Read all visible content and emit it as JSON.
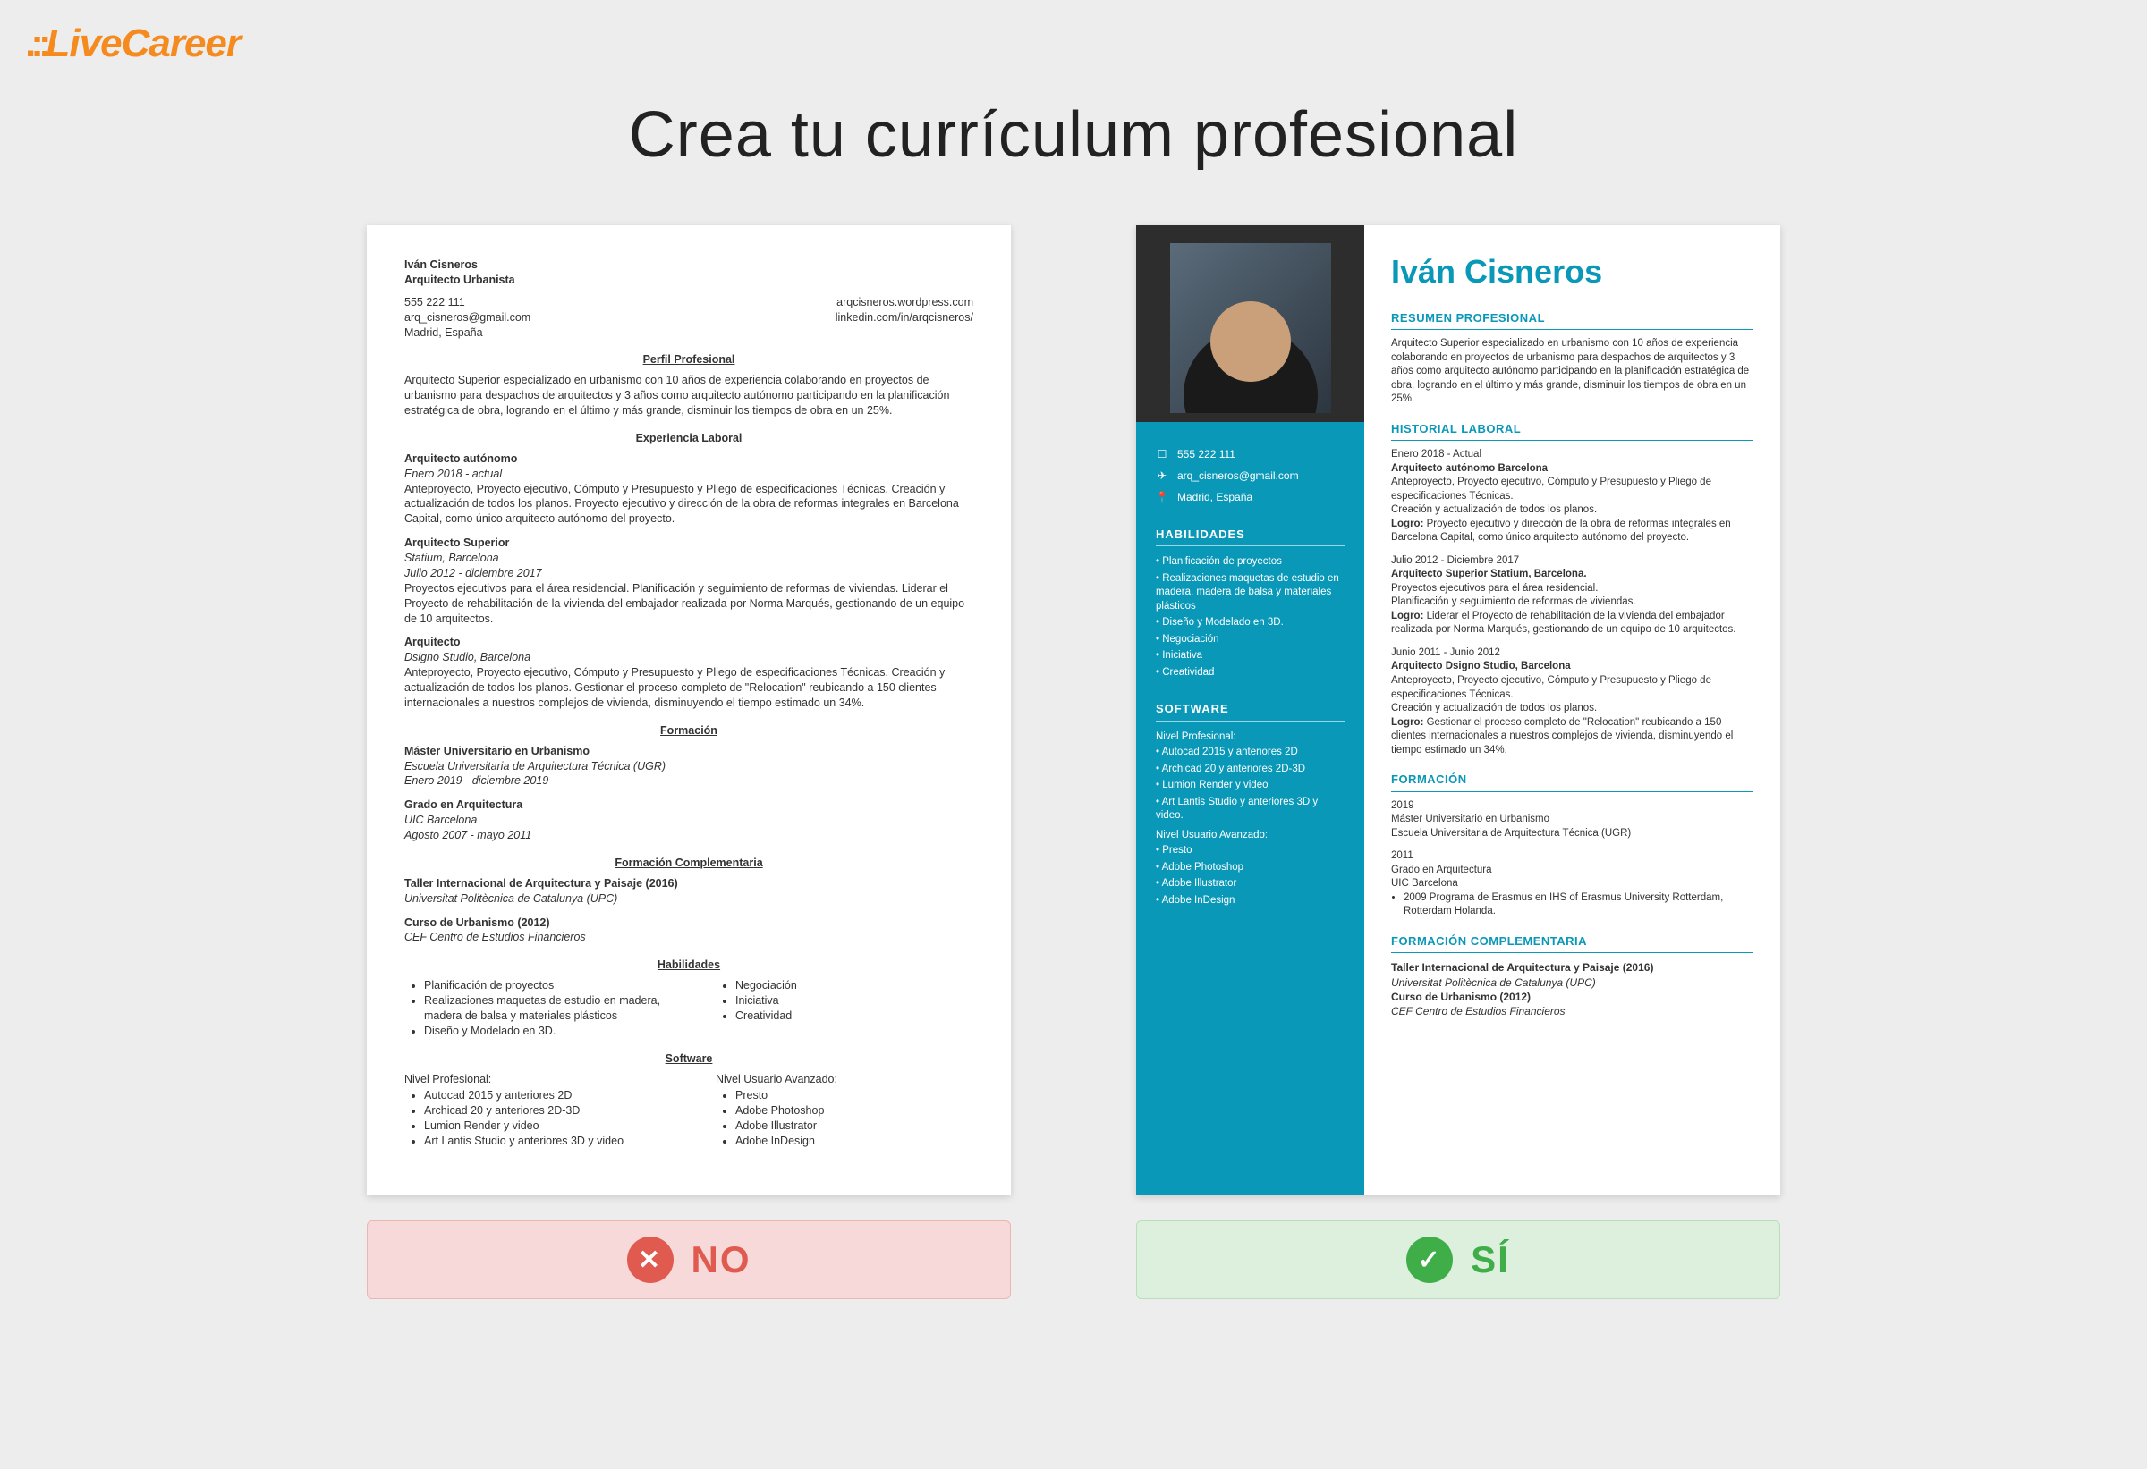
{
  "logo": "LiveCareer",
  "title": "Crea tu currículum profesional",
  "badges": {
    "no": "NO",
    "si": "SÍ"
  },
  "bad": {
    "name": "Iván Cisneros",
    "role": "Arquitecto Urbanista",
    "contact": {
      "phone": "555 222 111",
      "web": "arqcisneros.wordpress.com",
      "email": "arq_cisneros@gmail.com",
      "linkedin": "linkedin.com/in/arqcisneros/",
      "loc": "Madrid, España"
    },
    "sections": {
      "perfil_h": "Perfil Profesional",
      "perfil": "Arquitecto Superior especializado en urbanismo con 10 años de experiencia colaborando en proyectos de urbanismo para despachos de arquitectos y 3 años como arquitecto autónomo participando en la planificación estratégica de obra, logrando en el último y más grande, disminuir los tiempos de obra en un 25%.",
      "exp_h": "Experiencia Laboral",
      "jobs": [
        {
          "t": "Arquitecto autónomo",
          "d": "Enero 2018 - actual",
          "body": "Anteproyecto, Proyecto ejecutivo, Cómputo y Presupuesto y Pliego de especificaciones Técnicas. Creación y actualización de todos los planos. Proyecto ejecutivo y dirección de la obra de reformas integrales en Barcelona Capital, como único arquitecto autónomo del proyecto."
        },
        {
          "t": "Arquitecto Superior",
          "c": "Statium, Barcelona",
          "d": "Julio 2012 - diciembre 2017",
          "body": "Proyectos ejecutivos para el área residencial. Planificación y seguimiento de reformas de viviendas. Liderar el Proyecto de rehabilitación de la vivienda del embajador realizada por Norma Marqués, gestionando de un equipo de 10 arquitectos."
        },
        {
          "t": "Arquitecto",
          "c": "Dsigno Studio, Barcelona",
          "body": "Anteproyecto, Proyecto ejecutivo, Cómputo y Presupuesto y Pliego de especificaciones Técnicas. Creación y actualización de todos los planos. Gestionar el proceso completo de \"Relocation\" reubicando a 150 clientes internacionales a nuestros complejos de vivienda, disminuyendo el tiempo estimado un 34%."
        }
      ],
      "form_h": "Formación",
      "form": [
        {
          "t": "Máster Universitario en Urbanismo",
          "c": "Escuela Universitaria de Arquitectura Técnica (UGR)",
          "d": "Enero 2019 - diciembre 2019"
        },
        {
          "t": "Grado en Arquitectura",
          "c": "UIC Barcelona",
          "d": "Agosto 2007 - mayo 2011"
        }
      ],
      "formc_h": "Formación Complementaria",
      "formc": [
        {
          "t": "Taller Internacional de Arquitectura y Paisaje (2016)",
          "c": "Universitat Politècnica de Catalunya (UPC)"
        },
        {
          "t": "Curso de Urbanismo (2012)",
          "c": "CEF Centro de Estudios Financieros"
        }
      ],
      "hab_h": "Habilidades",
      "hab_l": [
        "Planificación de proyectos",
        "Realizaciones maquetas de estudio en madera, madera de balsa y materiales plásticos",
        "Diseño y Modelado en 3D."
      ],
      "hab_r": [
        "Negociación",
        "Iniciativa",
        "Creatividad"
      ],
      "sw_h": "Software",
      "sw_l_label": "Nivel Profesional:",
      "sw_l": [
        "Autocad 2015 y anteriores 2D",
        "Archicad 20 y anteriores 2D-3D",
        "Lumion Render y video",
        "Art Lantis Studio y anteriores 3D y video"
      ],
      "sw_r_label": "Nivel Usuario Avanzado:",
      "sw_r": [
        "Presto",
        "Adobe Photoshop",
        "Adobe Illustrator",
        "Adobe InDesign"
      ]
    }
  },
  "good": {
    "name": "Iván Cisneros",
    "contact": {
      "phone": "555 222 111",
      "email": "arq_cisneros@gmail.com",
      "loc": "Madrid, España"
    },
    "side": {
      "hab_h": "HABILIDADES",
      "hab": [
        "Planificación de proyectos",
        "Realizaciones maquetas de estudio en madera, madera de balsa y materiales plásticos",
        "Diseño y Modelado en 3D.",
        "Negociación",
        "Iniciativa",
        "Creatividad"
      ],
      "sw_h": "SOFTWARE",
      "sw_pro_label": "Nivel Profesional:",
      "sw_pro": [
        "Autocad 2015 y anteriores 2D",
        "Archicad 20 y anteriores 2D-3D",
        "Lumion Render y video",
        "Art Lantis Studio y anteriores 3D y video."
      ],
      "sw_adv_label": "Nivel Usuario Avanzado:",
      "sw_adv": [
        "Presto",
        "Adobe Photoshop",
        "Adobe Illustrator",
        "Adobe InDesign"
      ]
    },
    "main": {
      "resumen_h": "RESUMEN PROFESIONAL",
      "resumen": "Arquitecto Superior especializado en urbanismo con 10 años de experiencia colaborando en proyectos de urbanismo para despachos de arquitectos y 3 años como arquitecto autónomo participando en la planificación estratégica de obra, logrando en el último y más grande, disminuir los tiempos de obra en un 25%.",
      "hist_h": "HISTORIAL LABORAL",
      "jobs": [
        {
          "d": "Enero 2018 - Actual",
          "t": "Arquitecto autónomo Barcelona",
          "l1": "Anteproyecto, Proyecto ejecutivo, Cómputo y Presupuesto y Pliego de especificaciones Técnicas.",
          "l2": "Creación y actualización de todos los planos.",
          "logro": "Logro: ",
          "lt": "Proyecto ejecutivo y dirección de la obra de reformas integrales en Barcelona Capital, como único arquitecto autónomo del proyecto."
        },
        {
          "d": "Julio 2012 - Diciembre 2017",
          "t": "Arquitecto Superior Statium, Barcelona.",
          "l1": "Proyectos ejecutivos para el área residencial.",
          "l2": "Planificación y seguimiento de reformas de viviendas.",
          "logro": "Logro: ",
          "lt": "Liderar el Proyecto de rehabilitación de la vivienda del embajador realizada por Norma Marqués, gestionando de un equipo de 10 arquitectos."
        },
        {
          "d": "Junio 2011 - Junio 2012",
          "t": "Arquitecto Dsigno Studio, Barcelona",
          "l1": "Anteproyecto, Proyecto ejecutivo, Cómputo y Presupuesto y Pliego de especificaciones Técnicas.",
          "l2": "Creación y actualización de todos los planos.",
          "logro": "Logro: ",
          "lt": "Gestionar el proceso completo de \"Relocation\" reubicando a 150 clientes internacionales a nuestros complejos de vivienda, disminuyendo el tiempo estimado un 34%."
        }
      ],
      "form_h": "FORMACIÓN",
      "form": [
        {
          "y": "2019",
          "t": "Máster Universitario en Urbanismo",
          "c": "Escuela Universitaria de Arquitectura Técnica (UGR)"
        },
        {
          "y": "2011",
          "t": "Grado en Arquitectura",
          "c": "UIC Barcelona",
          "extra": "2009 Programa de Erasmus en IHS of Erasmus University Rotterdam, Rotterdam Holanda."
        }
      ],
      "formc_h": "FORMACIÓN COMPLEMENTARIA",
      "formc": [
        {
          "t": "Taller Internacional de Arquitectura y Paisaje (2016)",
          "c": "Universitat Politècnica de Catalunya (UPC)"
        },
        {
          "t": "Curso de Urbanismo (2012)",
          "c": "CEF Centro de Estudios Financieros"
        }
      ]
    }
  }
}
